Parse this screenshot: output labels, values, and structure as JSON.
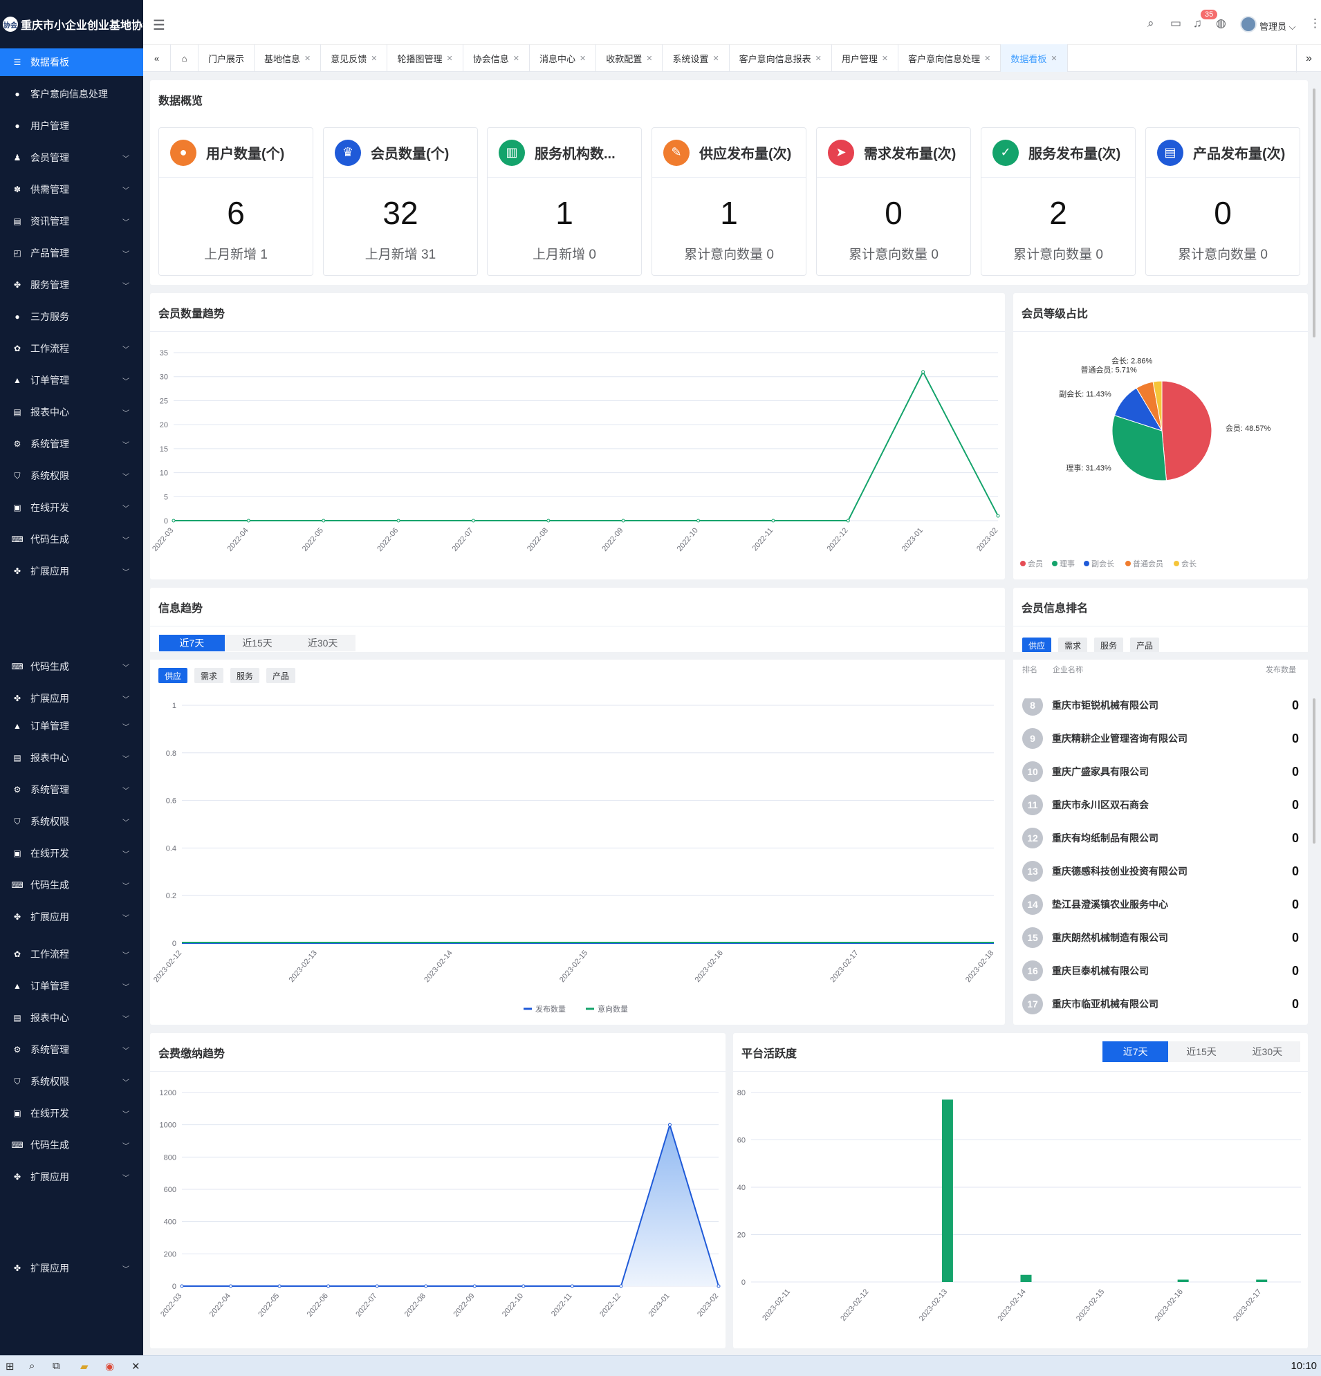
{
  "app": {
    "logo_mark": "协会",
    "title": "重庆市小企业创业基地协会"
  },
  "sidebar": {
    "items": [
      {
        "label": "数据看板",
        "icon": "table-icon",
        "glyph": "☰",
        "chevron": false,
        "active": true
      },
      {
        "label": "客户意向信息处理",
        "icon": "user-icon",
        "glyph": "●",
        "chevron": false
      },
      {
        "label": "用户管理",
        "icon": "user-icon",
        "glyph": "●",
        "chevron": false
      },
      {
        "label": "会员管理",
        "icon": "people-icon",
        "glyph": "♟",
        "chevron": true
      },
      {
        "label": "供需管理",
        "icon": "grid-icon",
        "glyph": "✽",
        "chevron": true
      },
      {
        "label": "资讯管理",
        "icon": "document-icon",
        "glyph": "▤",
        "chevron": true
      },
      {
        "label": "产品管理",
        "icon": "search-doc-icon",
        "glyph": "◰",
        "chevron": true
      },
      {
        "label": "服务管理",
        "icon": "apps-icon",
        "glyph": "✤",
        "chevron": true
      },
      {
        "label": "三方服务",
        "icon": "user-icon",
        "glyph": "●",
        "chevron": false
      },
      {
        "label": "工作流程",
        "icon": "workflow-icon",
        "glyph": "✿",
        "chevron": true
      },
      {
        "label": "订单管理",
        "icon": "triangle-icon",
        "glyph": "▲",
        "chevron": true
      },
      {
        "label": "报表中心",
        "icon": "report-icon",
        "glyph": "▤",
        "chevron": true
      },
      {
        "label": "系统管理",
        "icon": "gear-icon",
        "glyph": "⚙",
        "chevron": true
      },
      {
        "label": "系统权限",
        "icon": "shield-icon",
        "glyph": "⛉",
        "chevron": true
      },
      {
        "label": "在线开发",
        "icon": "terminal-icon",
        "glyph": "▣",
        "chevron": true
      },
      {
        "label": "代码生成",
        "icon": "code-icon",
        "glyph": "⌨",
        "chevron": true
      },
      {
        "label": "扩展应用",
        "icon": "apps-icon",
        "glyph": "✤",
        "chevron": true
      },
      {
        "label": "代码生成",
        "icon": "code-icon",
        "glyph": "⌨",
        "chevron": true
      },
      {
        "label": "扩展应用",
        "icon": "apps-icon",
        "glyph": "✤",
        "chevron": true
      },
      {
        "label": "订单管理",
        "icon": "triangle-icon",
        "glyph": "▲",
        "chevron": true
      },
      {
        "label": "报表中心",
        "icon": "report-icon",
        "glyph": "▤",
        "chevron": true
      },
      {
        "label": "系统管理",
        "icon": "gear-icon",
        "glyph": "⚙",
        "chevron": true
      },
      {
        "label": "系统权限",
        "icon": "shield-icon",
        "glyph": "⛉",
        "chevron": true
      },
      {
        "label": "在线开发",
        "icon": "terminal-icon",
        "glyph": "▣",
        "chevron": true
      },
      {
        "label": "代码生成",
        "icon": "code-icon",
        "glyph": "⌨",
        "chevron": true
      },
      {
        "label": "扩展应用",
        "icon": "apps-icon",
        "glyph": "✤",
        "chevron": true
      },
      {
        "label": "工作流程",
        "icon": "workflow-icon",
        "glyph": "✿",
        "chevron": true
      },
      {
        "label": "订单管理",
        "icon": "triangle-icon",
        "glyph": "▲",
        "chevron": true
      },
      {
        "label": "报表中心",
        "icon": "report-icon",
        "glyph": "▤",
        "chevron": true
      },
      {
        "label": "系统管理",
        "icon": "gear-icon",
        "glyph": "⚙",
        "chevron": true
      },
      {
        "label": "系统权限",
        "icon": "shield-icon",
        "glyph": "⛉",
        "chevron": true
      },
      {
        "label": "在线开发",
        "icon": "terminal-icon",
        "glyph": "▣",
        "chevron": true
      },
      {
        "label": "代码生成",
        "icon": "code-icon",
        "glyph": "⌨",
        "chevron": true
      },
      {
        "label": "扩展应用",
        "icon": "apps-icon",
        "glyph": "✤",
        "chevron": true
      },
      {
        "label": "扩展应用",
        "icon": "apps-icon",
        "glyph": "✤",
        "chevron": true
      }
    ]
  },
  "header": {
    "badge_count": "35",
    "username": "管理员",
    "user_chevron": "⌵"
  },
  "tabs": [
    {
      "label": "门户展示",
      "closable": false
    },
    {
      "label": "基地信息",
      "closable": true
    },
    {
      "label": "意见反馈",
      "closable": true
    },
    {
      "label": "轮播图管理",
      "closable": true
    },
    {
      "label": "协会信息",
      "closable": true
    },
    {
      "label": "消息中心",
      "closable": true
    },
    {
      "label": "收款配置",
      "closable": true
    },
    {
      "label": "系统设置",
      "closable": true
    },
    {
      "label": "客户意向信息报表",
      "closable": true
    },
    {
      "label": "用户管理",
      "closable": true
    },
    {
      "label": "客户意向信息处理",
      "closable": true
    },
    {
      "label": "数据看板",
      "closable": true,
      "active": true
    }
  ],
  "overview": {
    "title": "数据概览",
    "stats": [
      {
        "label": "用户数量(个)",
        "value": "6",
        "sub": "上月新增 1",
        "color": "#f07c2e",
        "icon": "user-icon",
        "glyph": "●"
      },
      {
        "label": "会员数量(个)",
        "value": "32",
        "sub": "上月新增 31",
        "color": "#1f5ad8",
        "icon": "crown-icon",
        "glyph": "♛"
      },
      {
        "label": "服务机构数...",
        "value": "1",
        "sub": "上月新增 0",
        "color": "#14a36b",
        "icon": "building-icon",
        "glyph": "▥"
      },
      {
        "label": "供应发布量(次)",
        "value": "1",
        "sub": "累计意向数量 0",
        "color": "#f07c2e",
        "icon": "edit-icon",
        "glyph": "✎"
      },
      {
        "label": "需求发布量(次)",
        "value": "0",
        "sub": "累计意向数量 0",
        "color": "#e6414f",
        "icon": "send-icon",
        "glyph": "➤"
      },
      {
        "label": "服务发布量(次)",
        "value": "2",
        "sub": "累计意向数量 0",
        "color": "#14a36b",
        "icon": "checklist-icon",
        "glyph": "✓"
      },
      {
        "label": "产品发布量(次)",
        "value": "0",
        "sub": "累计意向数量 0",
        "color": "#1f5ad8",
        "icon": "clipboard-icon",
        "glyph": "▤"
      }
    ]
  },
  "member_trend": {
    "title": "会员数量趋势"
  },
  "member_level": {
    "title": "会员等级占比"
  },
  "info_trend": {
    "title": "信息趋势",
    "ranges": [
      "近7天",
      "近15天",
      "近30天"
    ],
    "types": [
      "供应",
      "需求",
      "服务",
      "产品"
    ]
  },
  "ranking": {
    "title": "会员信息排名",
    "types": [
      "供应",
      "需求",
      "服务",
      "产品"
    ],
    "col_rank": "排名",
    "col_name": "企业名称",
    "col_count": "发布数量",
    "rows": [
      {
        "rank": "8",
        "name": "重庆市钜锐机械有限公司",
        "value": "0"
      },
      {
        "rank": "9",
        "name": "重庆精耕企业管理咨询有限公司",
        "value": "0"
      },
      {
        "rank": "10",
        "name": "重庆广盛家具有限公司",
        "value": "0"
      },
      {
        "rank": "11",
        "name": "重庆市永川区双石商会",
        "value": "0"
      },
      {
        "rank": "12",
        "name": "重庆有均纸制品有限公司",
        "value": "0"
      },
      {
        "rank": "13",
        "name": "重庆德感科技创业投资有限公司",
        "value": "0"
      },
      {
        "rank": "14",
        "name": "垫江县澄溪镇农业服务中心",
        "value": "0"
      },
      {
        "rank": "15",
        "name": "重庆朗然机械制造有限公司",
        "value": "0"
      },
      {
        "rank": "16",
        "name": "重庆巨泰机械有限公司",
        "value": "0"
      },
      {
        "rank": "17",
        "name": "重庆市临亚机械有限公司",
        "value": "0"
      }
    ]
  },
  "fee_trend": {
    "title": "会费缴纳趋势"
  },
  "activity": {
    "title": "平台活跃度",
    "ranges": [
      "近7天",
      "近15天",
      "近30天"
    ]
  },
  "taskbar": {
    "clock": "10:10"
  },
  "chart_data": [
    {
      "type": "line",
      "id": "member_trend",
      "categories": [
        "2022-03",
        "2022-04",
        "2022-05",
        "2022-06",
        "2022-07",
        "2022-08",
        "2022-09",
        "2022-10",
        "2022-11",
        "2022-12",
        "2023-01",
        "2023-02"
      ],
      "values": [
        0,
        0,
        0,
        0,
        0,
        0,
        0,
        0,
        0,
        0,
        31,
        1
      ],
      "ylim": [
        0,
        35
      ],
      "yticks": [
        0,
        5,
        10,
        15,
        20,
        25,
        30,
        35
      ],
      "color": "#14a36b",
      "grid": true
    },
    {
      "type": "pie",
      "id": "member_level",
      "series": [
        {
          "name": "会员",
          "value": 48.57,
          "label": "会员: 48.57%",
          "color": "#e54d55"
        },
        {
          "name": "理事",
          "value": 31.43,
          "label": "理事: 31.43%",
          "color": "#14a36b"
        },
        {
          "name": "副会长",
          "value": 11.43,
          "label": "副会长: 11.43%",
          "color": "#1f5ad8"
        },
        {
          "name": "普通会员",
          "value": 5.71,
          "label": "普通会员: 5.71%",
          "color": "#f07c2e"
        },
        {
          "name": "会长",
          "value": 2.86,
          "label": "会长: 2.86%",
          "color": "#f5c53a"
        }
      ],
      "legend": "bottom"
    },
    {
      "type": "line",
      "id": "info_trend",
      "categories": [
        "2023-02-12",
        "2023-02-13",
        "2023-02-14",
        "2023-02-15",
        "2023-02-16",
        "2023-02-17",
        "2023-02-18"
      ],
      "series": [
        {
          "name": "发布数量",
          "values": [
            0,
            0,
            0,
            0,
            0,
            0,
            0
          ],
          "color": "#1f5ad8"
        },
        {
          "name": "意向数量",
          "values": [
            0,
            0,
            0,
            0,
            0,
            0,
            0
          ],
          "color": "#14a36b"
        }
      ],
      "ylim": [
        0,
        1
      ],
      "yticks": [
        0,
        0.2,
        0.4,
        0.6,
        0.8,
        1
      ],
      "legend": "bottom"
    },
    {
      "type": "area",
      "id": "fee_trend",
      "categories": [
        "2022-03",
        "2022-04",
        "2022-05",
        "2022-06",
        "2022-07",
        "2022-08",
        "2022-09",
        "2022-10",
        "2022-11",
        "2022-12",
        "2023-01",
        "2023-02"
      ],
      "values": [
        0,
        0,
        0,
        0,
        0,
        0,
        0,
        0,
        0,
        0,
        1000,
        0
      ],
      "ylim": [
        0,
        1200
      ],
      "yticks": [
        0,
        200,
        400,
        600,
        800,
        1000,
        1200
      ],
      "color": "#1f5ad8"
    },
    {
      "type": "bar",
      "id": "activity",
      "categories": [
        "2023-02-11",
        "2023-02-12",
        "2023-02-13",
        "2023-02-14",
        "2023-02-15",
        "2023-02-16",
        "2023-02-17"
      ],
      "values": [
        0,
        0,
        77,
        3,
        0,
        1,
        1
      ],
      "ylim": [
        0,
        80
      ],
      "yticks": [
        0,
        20,
        40,
        60,
        80
      ],
      "color": "#14a36b"
    }
  ]
}
